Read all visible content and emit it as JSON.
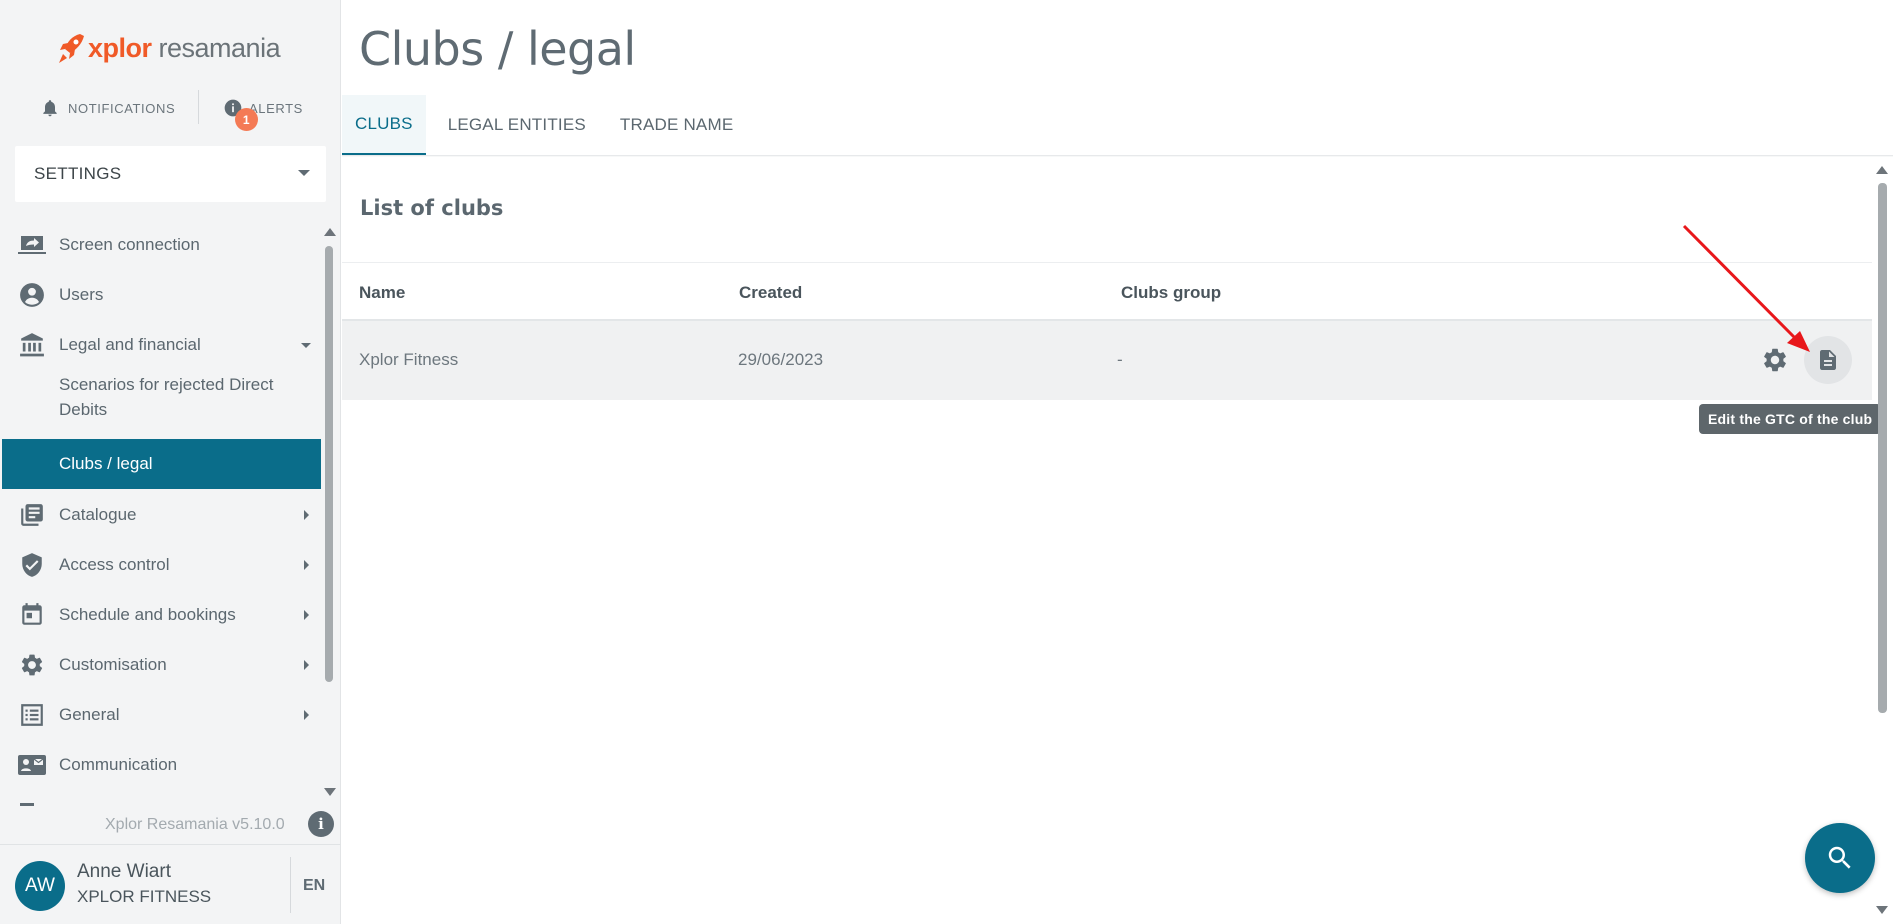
{
  "app": {
    "logo_text_brand": "xplor",
    "logo_text_product": "resamania",
    "version": "Xplor Resamania v5.10.0"
  },
  "topbar": {
    "notifications_label": "NOTIFICATIONS",
    "alerts_label": "ALERTS",
    "alerts_count": "1"
  },
  "sidebar": {
    "settings_label": "SETTINGS",
    "items": [
      {
        "label": "Screen connection",
        "icon": "screen-share-icon"
      },
      {
        "label": "Users",
        "icon": "account-circle-icon"
      },
      {
        "label": "Legal and financial",
        "icon": "bank-icon",
        "expanded": true
      },
      {
        "label": "Catalogue",
        "icon": "library-books-icon"
      },
      {
        "label": "Access control",
        "icon": "shield-check-icon"
      },
      {
        "label": "Schedule and bookings",
        "icon": "calendar-icon"
      },
      {
        "label": "Customisation",
        "icon": "gear-icon"
      },
      {
        "label": "General",
        "icon": "list-icon"
      },
      {
        "label": "Communication",
        "icon": "contact-mail-icon"
      }
    ],
    "subitems": [
      {
        "label": "Scenarios for rejected Direct Debits"
      },
      {
        "label": "Clubs / legal",
        "active": true
      }
    ]
  },
  "user": {
    "initials": "AW",
    "name": "Anne Wiart",
    "club": "XPLOR FITNESS",
    "language": "EN"
  },
  "main": {
    "title": "Clubs / legal",
    "tabs": [
      {
        "label": "CLUBS",
        "active": true
      },
      {
        "label": "LEGAL ENTITIES"
      },
      {
        "label": "TRADE NAME"
      }
    ],
    "panel_title": "List of clubs",
    "table": {
      "headers": [
        "Name",
        "Created",
        "Clubs group"
      ],
      "rows": [
        {
          "name": "Xplor Fitness",
          "created": "29/06/2023",
          "group": "-"
        }
      ]
    },
    "tooltip": "Edit the GTC of the club"
  },
  "colors": {
    "accent": "#0a6d8a",
    "brand_orange": "#f05a28",
    "badge": "#f47a55",
    "annotation_arrow": "#e8171b"
  }
}
